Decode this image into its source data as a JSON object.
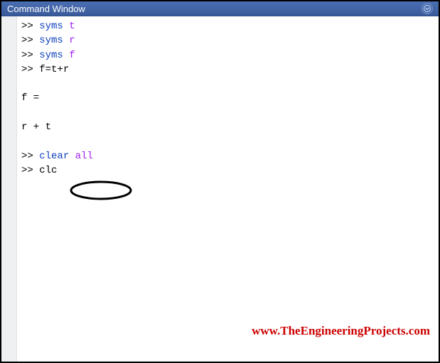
{
  "window": {
    "title": "Command Window"
  },
  "lines": [
    {
      "prompt": ">> ",
      "tokens": [
        {
          "class": "cmd-blue",
          "text": "syms"
        },
        {
          "class": "cmd-black",
          "text": " "
        },
        {
          "class": "cmd-purple",
          "text": "t"
        }
      ]
    },
    {
      "prompt": ">> ",
      "tokens": [
        {
          "class": "cmd-blue",
          "text": "syms"
        },
        {
          "class": "cmd-black",
          "text": " "
        },
        {
          "class": "cmd-purple",
          "text": "r"
        }
      ]
    },
    {
      "prompt": ">> ",
      "tokens": [
        {
          "class": "cmd-blue",
          "text": "syms"
        },
        {
          "class": "cmd-black",
          "text": " "
        },
        {
          "class": "cmd-purple",
          "text": "f"
        }
      ]
    },
    {
      "prompt": ">> ",
      "tokens": [
        {
          "class": "cmd-black",
          "text": "f=t+r"
        }
      ]
    },
    {
      "prompt": "",
      "tokens": [
        {
          "class": "cmd-black",
          "text": " "
        }
      ]
    },
    {
      "prompt": "",
      "tokens": [
        {
          "class": "cmd-black",
          "text": "f ="
        }
      ]
    },
    {
      "prompt": "",
      "tokens": [
        {
          "class": "cmd-black",
          "text": " "
        }
      ]
    },
    {
      "prompt": "",
      "tokens": [
        {
          "class": "cmd-black",
          "text": "r + t"
        }
      ]
    },
    {
      "prompt": "",
      "tokens": [
        {
          "class": "cmd-black",
          "text": " "
        }
      ]
    },
    {
      "prompt": ">> ",
      "tokens": [
        {
          "class": "cmd-blue",
          "text": "clear"
        },
        {
          "class": "cmd-black",
          "text": " "
        },
        {
          "class": "cmd-purple",
          "text": "all"
        }
      ]
    },
    {
      "prompt": ">> ",
      "tokens": [
        {
          "class": "cmd-black",
          "text": "clc"
        }
      ]
    }
  ],
  "watermark": {
    "text": "www.TheEngineeringProjects.com"
  }
}
